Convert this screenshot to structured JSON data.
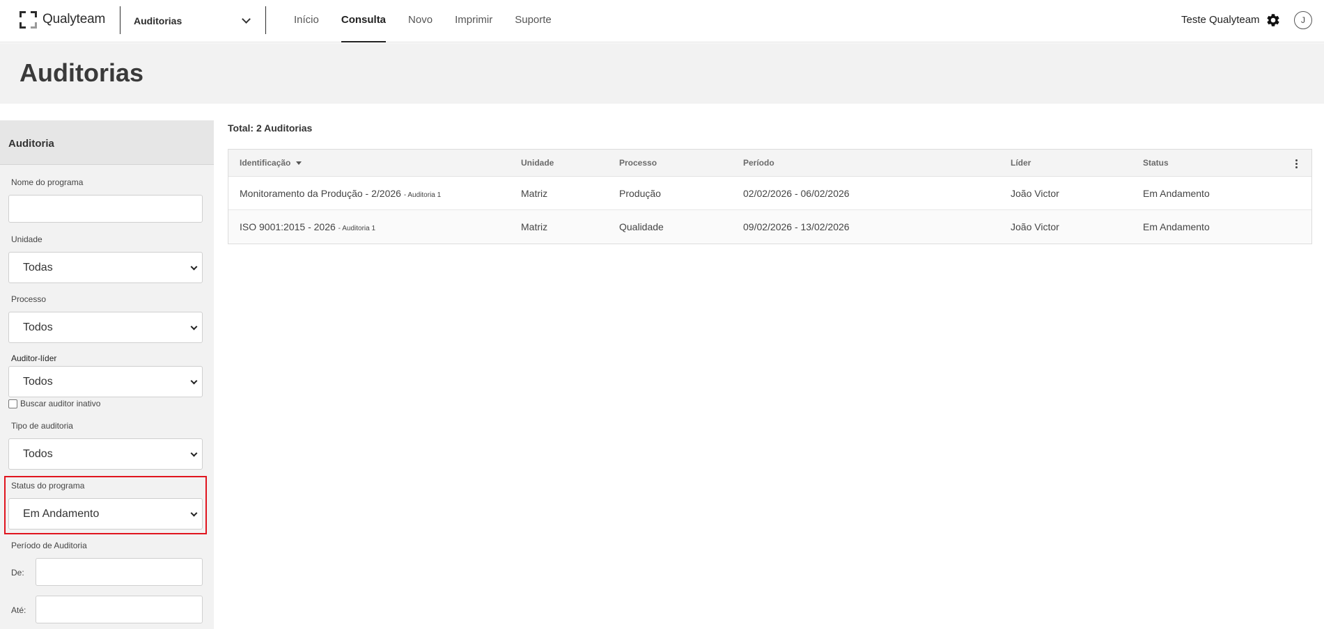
{
  "brand": {
    "name": "Qualyteam"
  },
  "module_selector": {
    "label": "Auditorias"
  },
  "nav": [
    {
      "label": "Início"
    },
    {
      "label": "Consulta"
    },
    {
      "label": "Novo"
    },
    {
      "label": "Imprimir"
    },
    {
      "label": "Suporte"
    }
  ],
  "nav_active": "Consulta",
  "user": {
    "name": "Teste Qualyteam",
    "initial": "J"
  },
  "page": {
    "title": "Auditorias"
  },
  "sidebar": {
    "title": "Auditoria",
    "program_name": {
      "label": "Nome do programa",
      "value": ""
    },
    "unit": {
      "label": "Unidade",
      "value": "Todas"
    },
    "process": {
      "label": "Processo",
      "value": "Todos"
    },
    "lead_auditor": {
      "label": "Auditor-líder",
      "value": "Todos"
    },
    "inactive_auditor": {
      "label": "Buscar auditor inativo",
      "checked": false
    },
    "audit_type": {
      "label": "Tipo de auditoria",
      "value": "Todos"
    },
    "program_status": {
      "label": "Status do programa",
      "value": "Em Andamento"
    },
    "audit_period": {
      "label": "Período de Auditoria",
      "from_label": "De:",
      "to_label": "Até:",
      "from_value": "",
      "to_value": ""
    }
  },
  "results": {
    "total_label": "Total: 2 Auditorias",
    "columns": {
      "id": "Identificação",
      "unit": "Unidade",
      "process": "Processo",
      "period": "Período",
      "leader": "Líder",
      "status": "Status"
    },
    "rows": [
      {
        "id": "Monitoramento da Produção - 2/2026",
        "id_suffix": "- Auditoria 1",
        "unit": "Matriz",
        "process": "Produção",
        "period": "02/02/2026 - 06/02/2026",
        "leader": "João Victor",
        "status": "Em Andamento"
      },
      {
        "id": "ISO 9001:2015 - 2026",
        "id_suffix": "- Auditoria 1",
        "unit": "Matriz",
        "process": "Qualidade",
        "period": "09/02/2026 - 13/02/2026",
        "leader": "João Victor",
        "status": "Em Andamento"
      }
    ]
  },
  "colors": {
    "highlight": "#e0141e",
    "header_bg": "#f2f2f2",
    "text": "#333333"
  },
  "icons": [
    "logo-mark-icon",
    "chevron-down-icon",
    "gear-icon",
    "kebab-menu-icon",
    "sort-desc-icon"
  ]
}
